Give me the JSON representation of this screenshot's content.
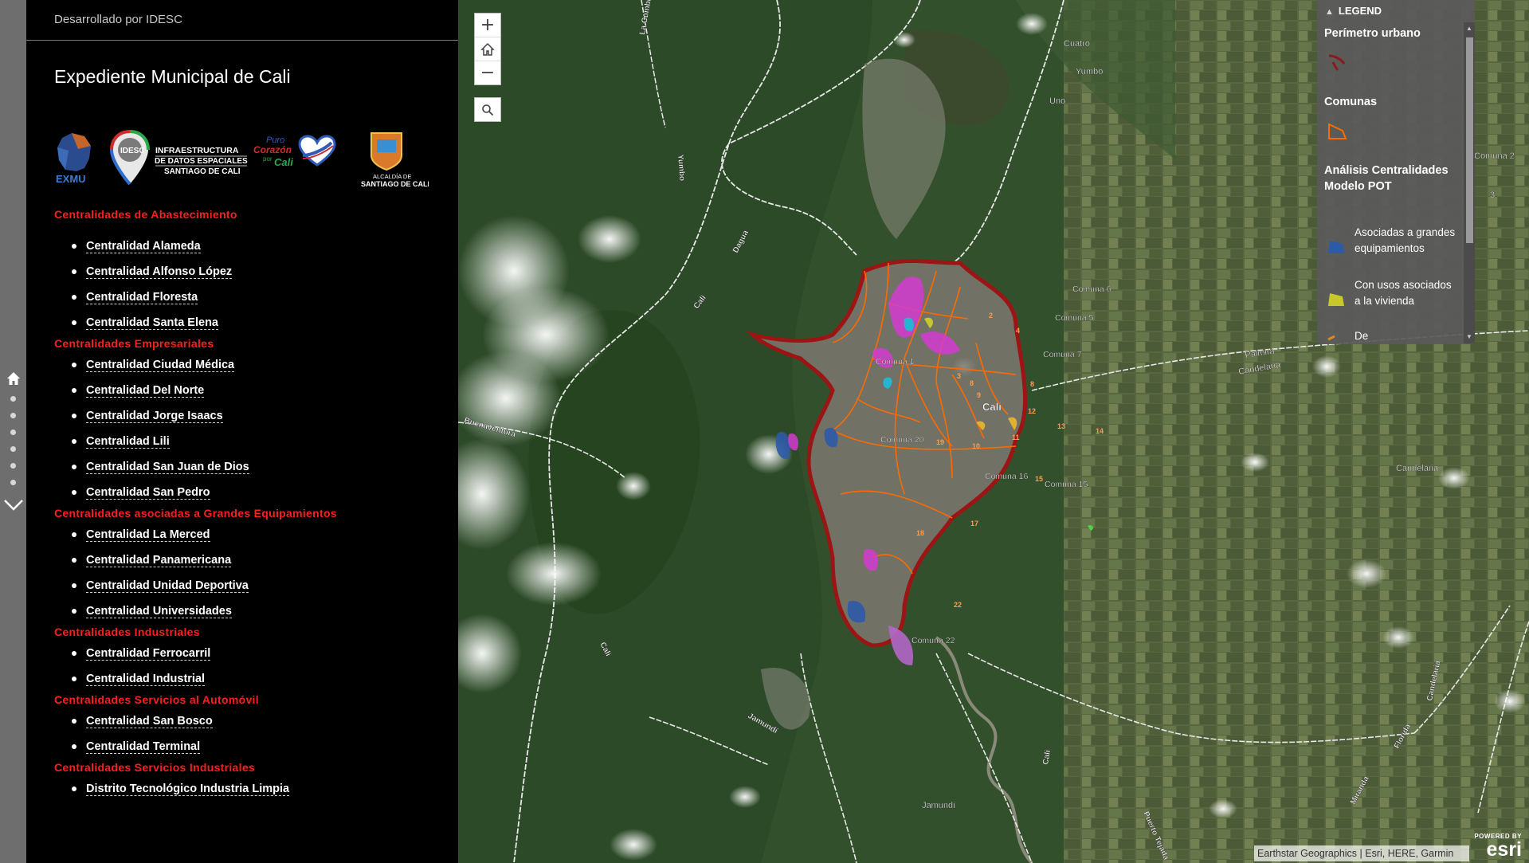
{
  "panel": {
    "credit": "Desarrollado por IDESC",
    "title": "Expediente Municipal de Cali",
    "logos": {
      "exmu": "EXMU",
      "idesc_badge": "IDESC",
      "idesc_text": [
        "INFRAESTRUCTURA",
        "DE DATOS ESPACIALES",
        "SANTIAGO DE CALI"
      ],
      "puro_1": "Puro",
      "puro_2": "Corazón",
      "puro_3": "por",
      "puro_4": "Cali",
      "alcaldia_1": "ALCALDÍA DE",
      "alcaldia_2": "SANTIAGO DE CALI"
    },
    "sections": [
      {
        "title": "Centralidades de Abastecimiento",
        "items": [
          "Centralidad Alameda",
          "Centralidad Alfonso López",
          "Centralidad Floresta",
          "Centralidad Santa Elena"
        ]
      },
      {
        "title": "Centralidades Empresariales",
        "items": [
          "Centralidad Ciudad Médica",
          "Centralidad Del Norte",
          "Centralidad Jorge Isaacs",
          "Centralidad Lili",
          "Centralidad San Juan de Dios",
          "Centralidad San Pedro"
        ]
      },
      {
        "title": "Centralidades asociadas a Grandes Equipamientos",
        "items": [
          "Centralidad La Merced",
          "Centralidad Panamericana",
          "Centralidad Unidad Deportiva",
          "Centralidad Universidades"
        ]
      },
      {
        "title": "Centralidades Industriales",
        "items": [
          "Centralidad Ferrocarril",
          "Centralidad Industrial"
        ]
      },
      {
        "title": "Centralidades Servicios al Automóvil",
        "items": [
          "Centralidad San Bosco",
          "Centralidad Terminal"
        ]
      },
      {
        "title": "Centralidades Servicios Industriales",
        "items": [
          "Distrito Tecnológico Industria Limpia"
        ]
      }
    ]
  },
  "map": {
    "zoom_in": "+",
    "zoom_out": "−",
    "place_labels": {
      "cuatro": "Cuatro",
      "yumbo": "Yumbo",
      "uno": "Uno",
      "cali": "Cali",
      "palmira": "Palmira",
      "candelaria": "Candelaria",
      "candelaria2": "Candelaria",
      "jamundi": "Jamundí",
      "comuna2": "Comuna 2",
      "c3": "3"
    },
    "road_labels": {
      "dagua": "Dagua",
      "cali_a": "Cali",
      "yumbo": "Yumbo",
      "la_cumbre": "La Cumbre",
      "buenaventura": "Buenaventura",
      "cali_b": "Cali",
      "jamundi": "Jamundí",
      "cali_c": "Cali",
      "florida": "Florida",
      "miranda": "Miranda",
      "candelaria": "Candelaria",
      "puerto_tejada": "Puerto Tejada"
    },
    "comuna_labels": {
      "c1": "Comuna 1",
      "c5": "Comuna 5",
      "c6": "Comuna 6",
      "c7": "Comuna 7",
      "c15": "Comuna 15",
      "c16": "Comuna 16",
      "c20": "Comuna 20",
      "c22": "Comuna 22"
    },
    "numbers": [
      "2",
      "4",
      "3",
      "8",
      "9",
      "12",
      "13",
      "14",
      "11",
      "10",
      "19",
      "17",
      "18",
      "22",
      "15",
      "8"
    ]
  },
  "legend": {
    "title": "LEGEND",
    "layer1": "Perímetro urbano",
    "layer2": "Comunas",
    "layer3": "Análisis Centralidades Modelo POT",
    "class1": "Asociadas a grandes equipamientos",
    "class2": "Con usos asociados a la vivienda",
    "class3": "De",
    "colors": {
      "perimetro": "#8b1a1a",
      "comunas": "#ff6a00",
      "equipamientos": "#2d5aa8",
      "vivienda": "#c7c92a",
      "de": "#d98a1c"
    }
  },
  "attribution": "Earthstar Geographics | Esri, HERE, Garmin",
  "esri": {
    "powered": "POWERED BY",
    "brand": "esri"
  }
}
